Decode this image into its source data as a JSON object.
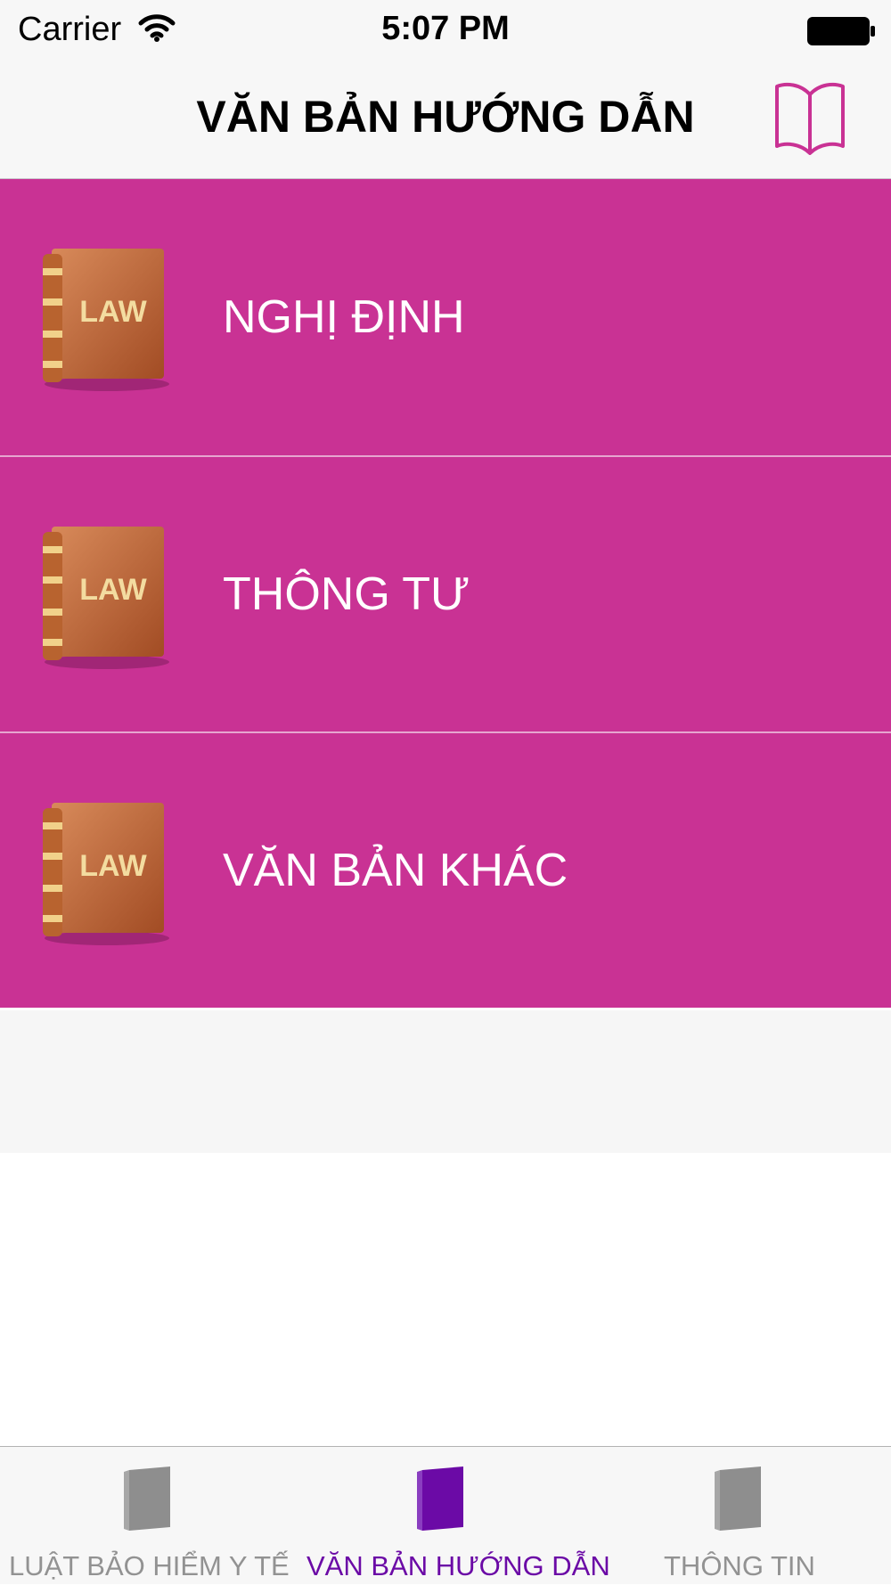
{
  "status_bar": {
    "carrier": "Carrier",
    "time": "5:07 PM",
    "wifi_icon": "wifi-icon",
    "battery_icon": "battery-icon"
  },
  "nav": {
    "title": "VĂN BẢN HƯỚNG DẪN",
    "right_icon": "open-book-icon"
  },
  "list": {
    "icon": "law-book-icon",
    "items": [
      {
        "label": "NGHỊ ĐỊNH"
      },
      {
        "label": "THÔNG TƯ"
      },
      {
        "label": "VĂN BẢN KHÁC"
      }
    ],
    "icon_text": "LAW"
  },
  "tab_bar": {
    "tabs": [
      {
        "label": "LUẬT BẢO HIỂM Y TẾ",
        "active": false
      },
      {
        "label": "VĂN BẢN HƯỚNG DẪN",
        "active": true
      },
      {
        "label": "THÔNG TIN",
        "active": false
      }
    ]
  },
  "colors": {
    "accent": "#c93294",
    "tab_active": "#6b0aa6",
    "tab_inactive": "#929292",
    "bar_background": "#f7f7f7"
  }
}
